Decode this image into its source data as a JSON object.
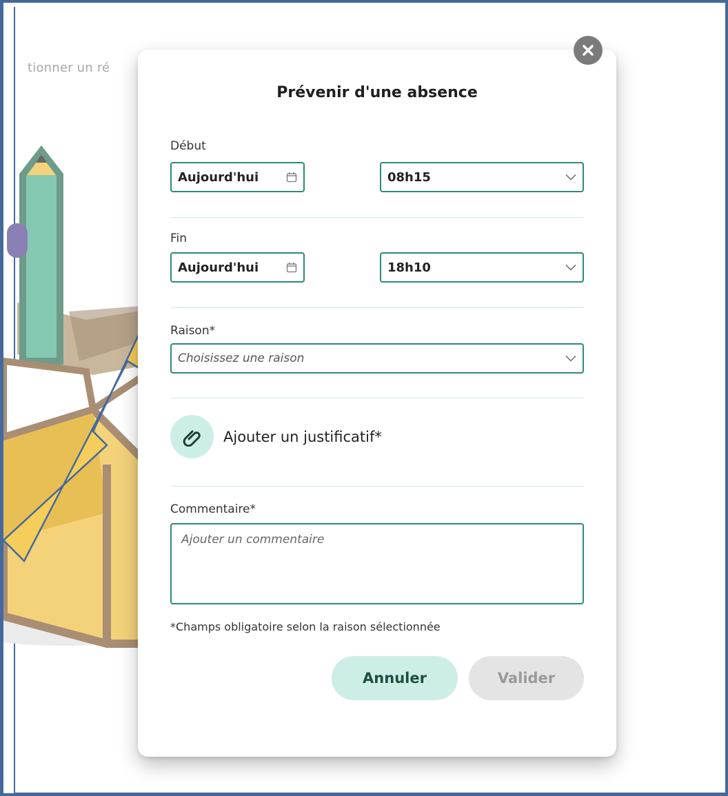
{
  "background": {
    "partial_text": "tionner un ré"
  },
  "modal": {
    "title": "Prévenir d'une absence",
    "start": {
      "label": "Début",
      "date_value": "Aujourd'hui",
      "time_value": "08h15"
    },
    "end": {
      "label": "Fin",
      "date_value": "Aujourd'hui",
      "time_value": "18h10"
    },
    "reason": {
      "label": "Raison*",
      "placeholder": "Choisissez une raison"
    },
    "attachment": {
      "label": "Ajouter un justificatif*",
      "icon": "paperclip-icon"
    },
    "comment": {
      "label": "Commentaire*",
      "placeholder": "Ajouter un commentaire"
    },
    "required_note": "*Champs obligatoire selon la raison sélectionnée",
    "buttons": {
      "cancel": "Annuler",
      "validate": "Valider"
    }
  },
  "colors": {
    "accent": "#2b8a78",
    "accent_light": "#cdeee6",
    "frame_border": "#44699d",
    "arrow": "#f5cd5a",
    "close_button": "#7b7b7b"
  }
}
